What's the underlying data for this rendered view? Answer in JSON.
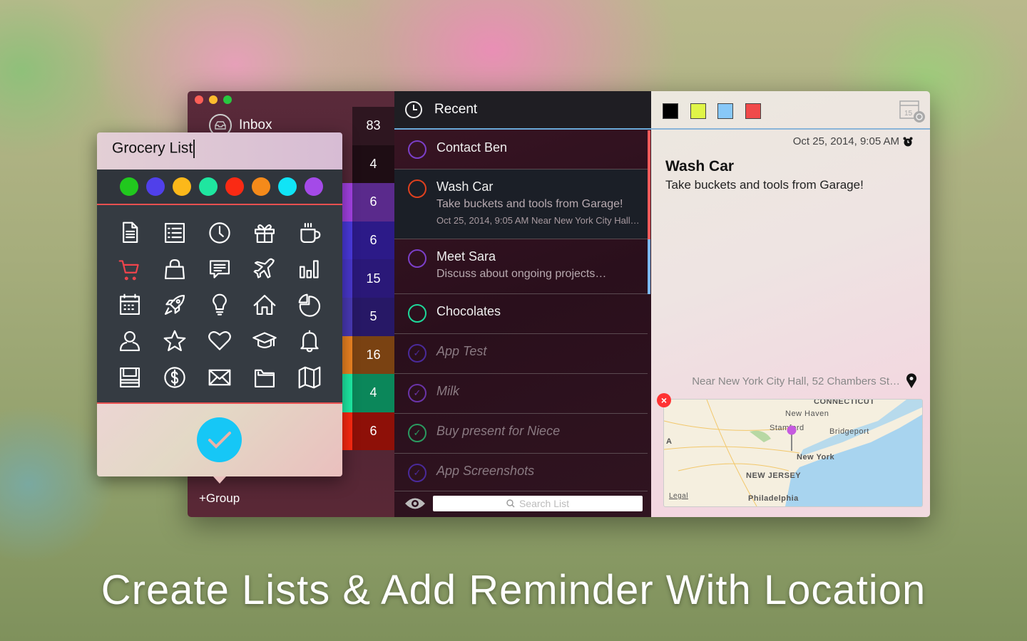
{
  "window": {
    "traffic_lights": [
      "#fc5f57",
      "#fdbc2e",
      "#28c840"
    ]
  },
  "sidebar": {
    "inbox_label": "Inbox",
    "add_group_label": "+Group",
    "counts": [
      {
        "value": "83",
        "bg": "#2e1620",
        "stripe": ""
      },
      {
        "value": "4",
        "bg": "#1e0d14",
        "stripe": ""
      },
      {
        "value": "6",
        "bg": "#5a2a8c",
        "stripe": "#a542e6"
      },
      {
        "value": "6",
        "bg": "#2c1a88",
        "stripe": "#4b3ae0"
      },
      {
        "value": "15",
        "bg": "#2a1878",
        "stripe": "#4a38d0"
      },
      {
        "value": "5",
        "bg": "#271866",
        "stripe": "#4a3ab8"
      },
      {
        "value": "16",
        "bg": "#7a4212",
        "stripe": "#f08522"
      },
      {
        "value": "4",
        "bg": "#0b875a",
        "stripe": "#1ef0a8"
      },
      {
        "value": "6",
        "bg": "#8e1008",
        "stripe": "#ff2a12"
      }
    ]
  },
  "popover": {
    "title": "Grocery List",
    "colors": [
      "#21c81e",
      "#5040ea",
      "#fcb81a",
      "#1fe6a0",
      "#fa2a14",
      "#f58a1a",
      "#10e4f6",
      "#a44ae8"
    ],
    "icons": [
      "document-icon",
      "list-icon",
      "clock-icon",
      "gift-icon",
      "coffee-cup-icon",
      "cart-icon",
      "shopping-bag-icon",
      "chat-icon",
      "airplane-icon",
      "bar-chart-icon",
      "calendar-icon",
      "rocket-icon",
      "lightbulb-icon",
      "home-icon",
      "pie-chart-icon",
      "user-icon",
      "star-icon",
      "heart-icon",
      "graduation-cap-icon",
      "bell-icon",
      "save-icon",
      "dollar-icon",
      "mail-icon",
      "folder-icon",
      "map-icon"
    ],
    "selected_icon": "cart-icon",
    "selected_color": "#f0444c",
    "confirm_icon": "checkmark-icon"
  },
  "list": {
    "header": "Recent",
    "search_placeholder": "Search List",
    "items": [
      {
        "title": "Contact Ben",
        "circle": "#7b3fc8",
        "done": false,
        "stripe": "#f05a5a"
      },
      {
        "title": "Wash Car",
        "subtitle": "Take buckets and tools from Garage!",
        "meta": "Oct 25, 2014, 9:05 AM Near New York City Hall…",
        "circle": "#e0401e",
        "done": false,
        "stripe": "#f05a5a",
        "selected": true
      },
      {
        "title": "Meet Sara",
        "subtitle": "Discuss about ongoing projects…",
        "circle": "#7b3fc8",
        "done": false,
        "stripe": "#7ab8f0"
      },
      {
        "title": "Chocolates",
        "circle": "#1ed99a",
        "done": false
      },
      {
        "title": "App Test",
        "circle": "#4a2a9a",
        "done": true
      },
      {
        "title": "Milk",
        "circle": "#6a34a8",
        "done": true
      },
      {
        "title": "Buy present for Niece",
        "circle": "#2a9a60",
        "done": true
      },
      {
        "title": "App Screenshots",
        "circle": "#4a2a9a",
        "done": true
      }
    ]
  },
  "detail": {
    "swatches": [
      "#000000",
      "#e0f548",
      "#88c8f8",
      "#f04a4a"
    ],
    "calendar_day": "15",
    "date": "Oct 25, 2014, 9:05 AM",
    "title": "Wash Car",
    "note": "Take buckets and tools from Garage!",
    "location": "Near New York City Hall, 52 Chambers St…",
    "map": {
      "labels": [
        "CONNECTICUT",
        "New Haven",
        "Stamford",
        "Bridgeport",
        "New York",
        "NEW JERSEY",
        "Philadelphia",
        "A"
      ],
      "legal": "Legal"
    }
  },
  "caption": "Create Lists & Add Reminder With Location"
}
